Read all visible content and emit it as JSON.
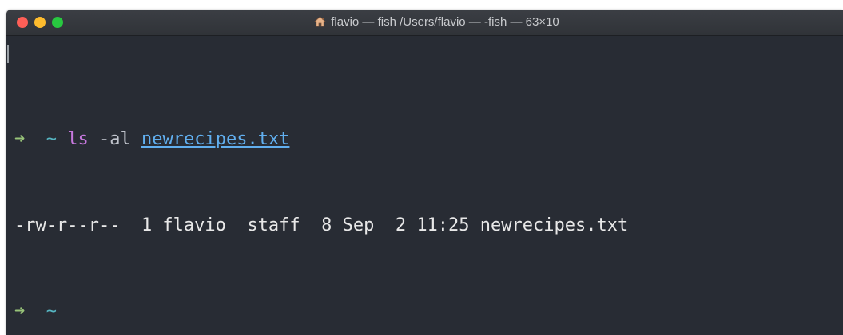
{
  "window": {
    "title": "flavio — fish /Users/flavio — -fish — 63×10",
    "title_icon": "home-icon"
  },
  "terminal": {
    "lines": [
      {
        "prompt_arrow": "➜",
        "cwd": "~",
        "command": "ls",
        "args": "-al",
        "file_arg": "newrecipes.txt"
      },
      {
        "output": "-rw-r--r--  1 flavio  staff  8 Sep  2 11:25 newrecipes.txt"
      },
      {
        "prompt_arrow": "➜",
        "cwd": "~"
      }
    ]
  },
  "colors": {
    "background": "#282c34",
    "prompt_arrow": "#98c379",
    "cwd": "#56b6c2",
    "command": "#c678dd",
    "file_arg": "#61afef",
    "text": "#e8e8e8"
  }
}
